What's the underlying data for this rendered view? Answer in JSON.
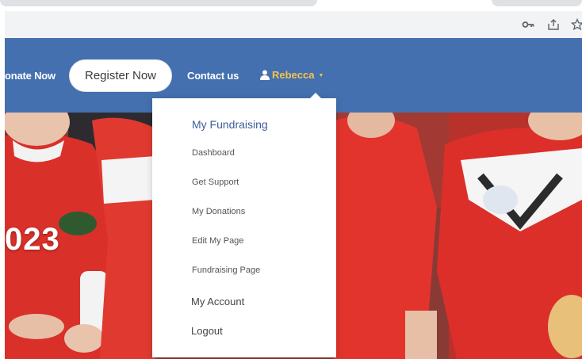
{
  "nav": {
    "donate_label": "onate Now",
    "register_label": "Register Now",
    "contact_label": "Contact us",
    "user_name": "Rebecca"
  },
  "hero": {
    "year_fragment": "023"
  },
  "dropdown": {
    "heading": "My Fundraising",
    "sub_items": [
      "Dashboard",
      "Get Support",
      "My Donations",
      "Edit My Page",
      "Fundraising Page"
    ],
    "account_label": "My Account",
    "logout_label": "Logout"
  },
  "icons": {
    "toolbar": [
      "key-icon",
      "share-icon",
      "star-icon"
    ],
    "user": "user-icon",
    "caret": "caret-down-icon"
  },
  "colors": {
    "nav_background": "#4470b0",
    "user_accent": "#f5c34a",
    "dropdown_heading": "#3d5d9b",
    "jersey_red": "#d9302a"
  }
}
